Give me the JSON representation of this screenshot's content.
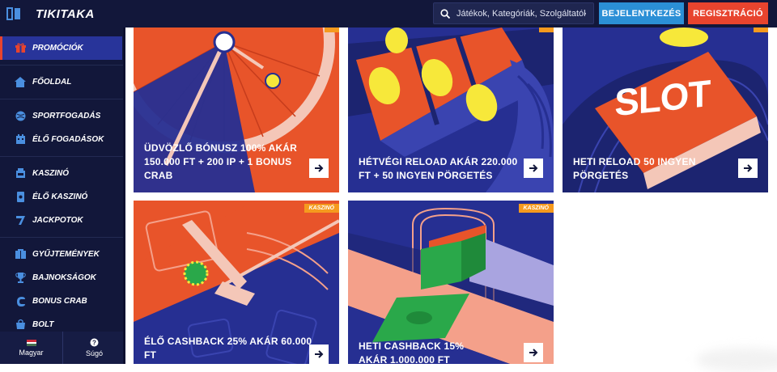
{
  "header": {
    "logo": "TIKITAKA",
    "search_placeholder": "Játékok, Kategóriák, Szolgáltatók",
    "login_label": "BEJELENTKEZÉS",
    "register_label": "REGISZTRÁCIÓ"
  },
  "sidebar": {
    "items": [
      {
        "label": "PROMÓCIÓK",
        "icon": "gift-icon"
      },
      {
        "label": "FŐOLDAL",
        "icon": "home-icon"
      },
      {
        "label": "SPORTFOGADÁS",
        "icon": "ball-icon"
      },
      {
        "label": "ÉLŐ FOGADÁSOK",
        "icon": "live-bets-icon"
      },
      {
        "label": "KASZINÓ",
        "icon": "casino-icon"
      },
      {
        "label": "ÉLŐ KASZINÓ",
        "icon": "card-icon"
      },
      {
        "label": "JACKPOTOK",
        "icon": "seven-icon"
      },
      {
        "label": "GYŰJTEMÉNYEK",
        "icon": "collection-icon"
      },
      {
        "label": "BAJNOKSÁGOK",
        "icon": "trophy-icon"
      },
      {
        "label": "BONUS CRAB",
        "icon": "crab-icon"
      },
      {
        "label": "BOLT",
        "icon": "shop-icon"
      }
    ],
    "language": "Magyar",
    "help": "Súgó"
  },
  "promos": [
    {
      "title": "ÜDVÖZLŐ BÓNUSZ 100% AKÁR 150.000 FT + 200 IP + 1 BONUS CRAB"
    },
    {
      "title": "HÉTVÉGI RELOAD AKÁR 220.000 FT + 50 INGYEN PÖRGETÉS"
    },
    {
      "title": "HETI RELOAD 50 INGYEN PÖRGETÉS",
      "art_text": "SLOT"
    },
    {
      "title": "ÉLŐ CASHBACK 25% AKÁR 60.000 FT",
      "badge": "KASZINÓ"
    },
    {
      "title": "HETI CASHBACK 15% AKÁR 1.000.000 FT",
      "badge": "KASZINÓ"
    }
  ],
  "colors": {
    "nav_bg": "#12173a",
    "login_blue": "#2b8fd6",
    "register_red": "#e8442e",
    "card_blue": "#262f92",
    "card_orange": "#e8542a",
    "badge_orange": "#f59a1e"
  }
}
